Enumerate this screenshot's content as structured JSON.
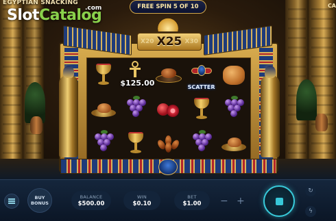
{
  "header": {
    "game_title": "EGYPTIAN SNACKING",
    "watermark_slot": "Slot",
    "watermark_catalog": "Catalog",
    "watermark_com": ".com",
    "corner_text": "CA",
    "free_spin_text": "FREE SPIN 5 OF 10"
  },
  "multiplier": {
    "left": "X20",
    "current": "X25",
    "right": "X30"
  },
  "reels": {
    "symbols": [
      [
        "chalice",
        "ankh-prize",
        "roast-bird",
        "scatter",
        "bread"
      ],
      [
        "bird-plate",
        "grapes",
        "pomegranate",
        "chalice",
        "grapes"
      ],
      [
        "grapes",
        "chalice",
        "dates",
        "grapes",
        "bird-plate"
      ]
    ],
    "prize_value": "$125.00",
    "scatter_label": "SCATTER"
  },
  "controls": {
    "buy_bonus_line1": "BUY",
    "buy_bonus_line2": "BONUS",
    "balance_label": "BALANCE",
    "balance_value": "$500.00",
    "win_label": "WIN",
    "win_value": "$0.10",
    "bet_label": "BET",
    "bet_value": "$1.00",
    "minus": "−",
    "plus": "+"
  },
  "colors": {
    "accent": "#38c9d9",
    "gold": "#d9b25a",
    "lapis": "#1e3b7a",
    "control_bg": "#0b1626"
  }
}
